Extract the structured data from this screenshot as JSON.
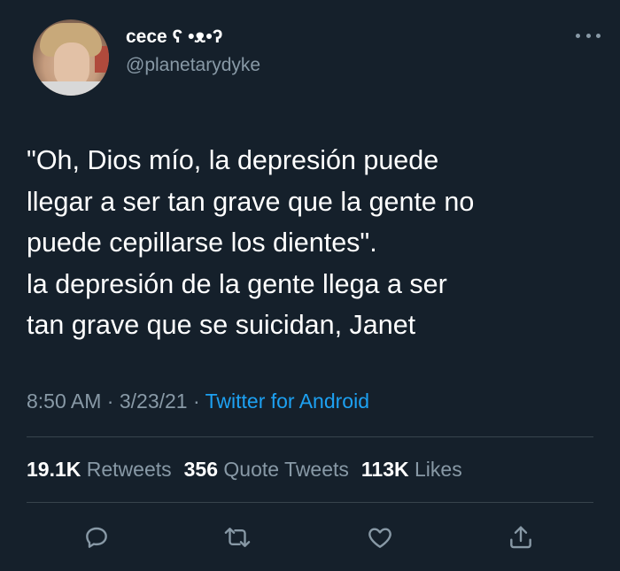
{
  "author": {
    "display_name": "cece ʕ •ᴥ•ʔ",
    "handle": "@planetarydyke"
  },
  "tweet": {
    "text": "\"Oh, Dios mío, la depresión puede\nllegar a ser tan grave que la gente no\npuede cepillarse los dientes\".\nla depresión de la gente llega a ser\ntan grave que se suicidan, Janet"
  },
  "meta": {
    "time": "8:50 AM",
    "separator1": " · ",
    "date": "3/23/21",
    "separator2": " · ",
    "source": "Twitter for Android"
  },
  "stats": {
    "retweets_count": "19.1K",
    "retweets_label": "Retweets",
    "quotes_count": "356",
    "quotes_label": "Quote Tweets",
    "likes_count": "113K",
    "likes_label": "Likes"
  },
  "icons": {
    "reply": "reply-icon",
    "retweet": "retweet-icon",
    "like": "like-icon",
    "share": "share-icon",
    "more": "more-icon"
  },
  "colors": {
    "background": "#15202b",
    "text": "#ffffff",
    "secondary_text": "#8899a6",
    "link": "#1da1f2",
    "divider": "#38444d"
  }
}
